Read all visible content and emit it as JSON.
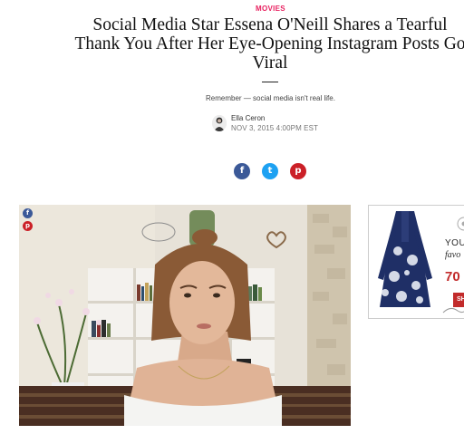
{
  "article": {
    "category": "MOVIES",
    "headline": "Social Media Star Essena O'Neill Shares a Tearful Thank You After Her Eye-Opening Instagram Posts Go Viral",
    "dek": "Remember — social media isn't real life.",
    "author": "Ella Ceron",
    "date": "NOV 3, 2015 4:00PM EST"
  },
  "share": {
    "facebook_icon": "f",
    "twitter_icon": "t",
    "pinterest_icon": "p"
  },
  "ad": {
    "line1": "YOU",
    "line2": "favo",
    "line3": "70",
    "cta": "SH"
  },
  "colors": {
    "accent": "#e8205f",
    "facebook": "#3b5998",
    "twitter": "#1da1f2",
    "pinterest": "#cb2027"
  }
}
